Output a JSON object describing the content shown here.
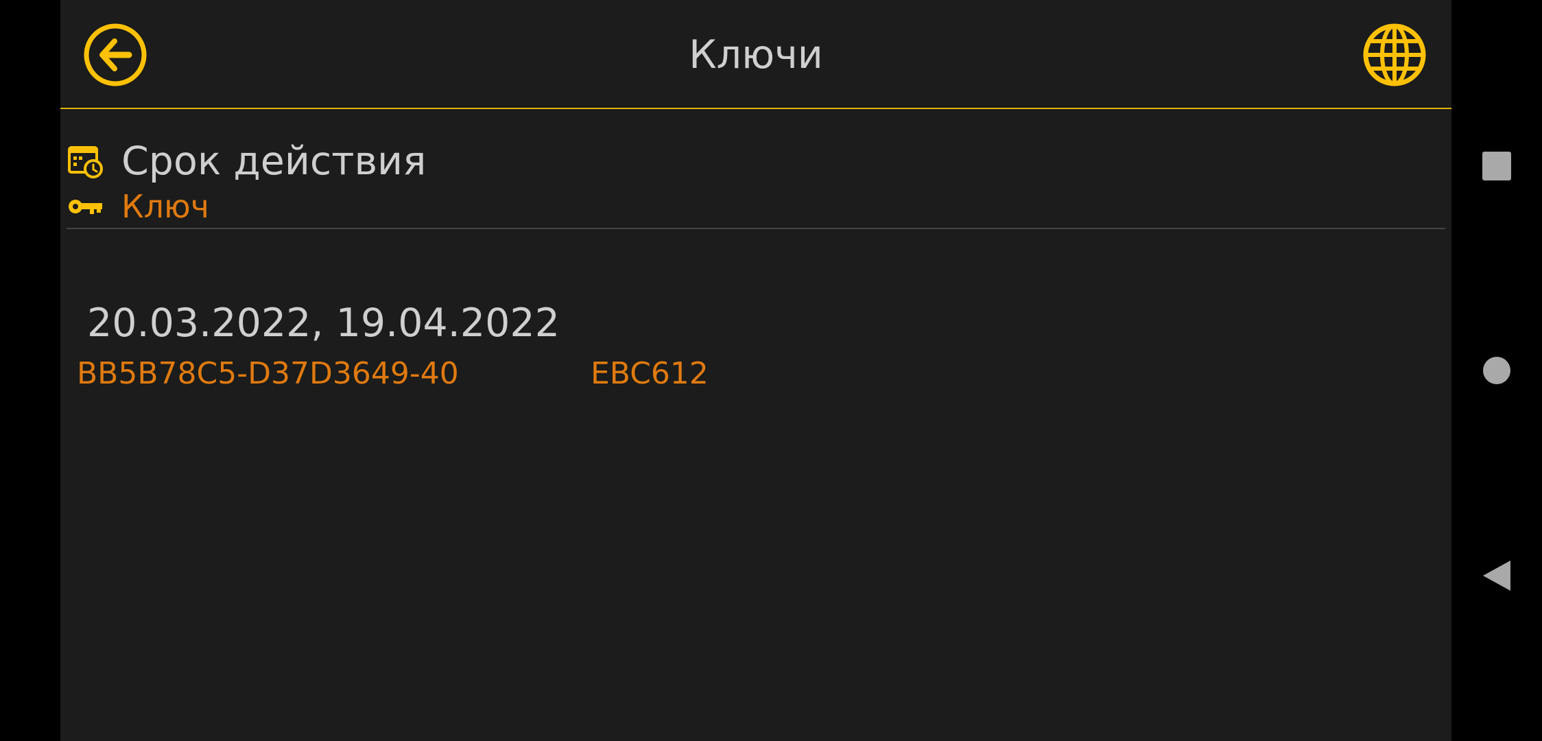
{
  "header": {
    "title": "Ключи",
    "back_icon": "arrow-left-circle-icon",
    "globe_icon": "globe-icon"
  },
  "legend": {
    "validity_label": "Срок действия",
    "validity_icon": "calendar-clock-icon",
    "key_label": "Ключ",
    "key_icon": "key-icon"
  },
  "keys": [
    {
      "dates": "20.03.2022, 19.04.2022",
      "id": "BB5B78C5-D37D3649-40",
      "suffix": "EBC612"
    }
  ],
  "navbar": {
    "recents_icon": "square-icon",
    "home_icon": "circle-icon",
    "back_icon": "triangle-back-icon"
  },
  "colors": {
    "accent": "#ffc107",
    "key_text": "#e07a10",
    "primary_text": "#cfcfcf",
    "background": "#1b1c1b"
  }
}
